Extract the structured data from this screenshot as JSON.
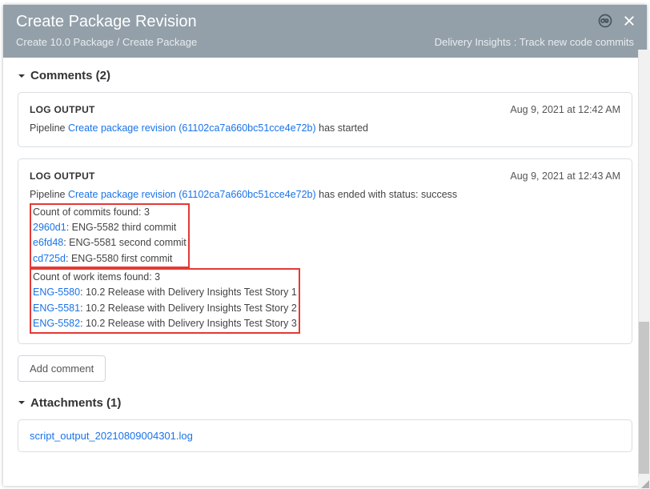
{
  "header": {
    "title": "Create Package Revision",
    "breadcrumb": "Create 10.0 Package / Create Package",
    "right_text": "Delivery Insights : Track new code commits"
  },
  "comments": {
    "heading": "Comments (2)",
    "add_button": "Add comment",
    "log1": {
      "label": "LOG OUTPUT",
      "time": "Aug 9, 2021 at 12:42 AM",
      "prefix": "Pipeline ",
      "link": "Create package revision (61102ca7a660bc51cce4e72b)",
      "suffix": " has started"
    },
    "log2": {
      "label": "LOG OUTPUT",
      "time": "Aug 9, 2021 at 12:43 AM",
      "prefix": "Pipeline ",
      "link": "Create package revision (61102ca7a660bc51cce4e72b)",
      "suffix": " has ended with status: success",
      "commits_header": "Count of commits found: 3",
      "c1_link": "2960d1",
      "c1_text": ": ENG-5582 third commit",
      "c2_link": "e6fd48",
      "c2_text": ": ENG-5581 second commit",
      "c3_link": "cd725d",
      "c3_text": ": ENG-5580 first commit",
      "work_header": "Count of work items found: 3",
      "w1_link": "ENG-5580",
      "w1_text": ": 10.2 Release with Delivery Insights Test Story 1",
      "w2_link": "ENG-5581",
      "w2_text": ": 10.2 Release with Delivery Insights Test Story 2",
      "w3_link": "ENG-5582",
      "w3_text": ": 10.2 Release with Delivery Insights Test Story 3"
    }
  },
  "attachments": {
    "heading": "Attachments (1)",
    "file": "script_output_20210809004301.log"
  }
}
